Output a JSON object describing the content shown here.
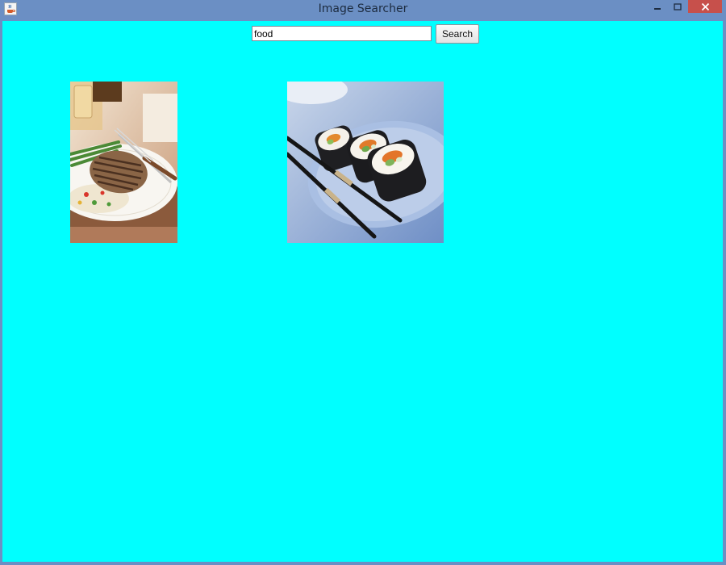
{
  "window": {
    "title": "Image Searcher",
    "app_icon": "java-coffee-icon",
    "controls": [
      "minimize-icon",
      "maximize-icon",
      "close-icon"
    ]
  },
  "colors": {
    "titlebar": "#6b8fc4",
    "client_background": "#00ffff",
    "close_button": "#c7504b"
  },
  "search": {
    "query": "food",
    "button_label": "Search"
  },
  "results": [
    {
      "name": "result-image-steak",
      "subject": "grilled steak with rice and asparagus"
    },
    {
      "name": "result-image-sushi",
      "subject": "sushi rolls with chopsticks"
    }
  ]
}
